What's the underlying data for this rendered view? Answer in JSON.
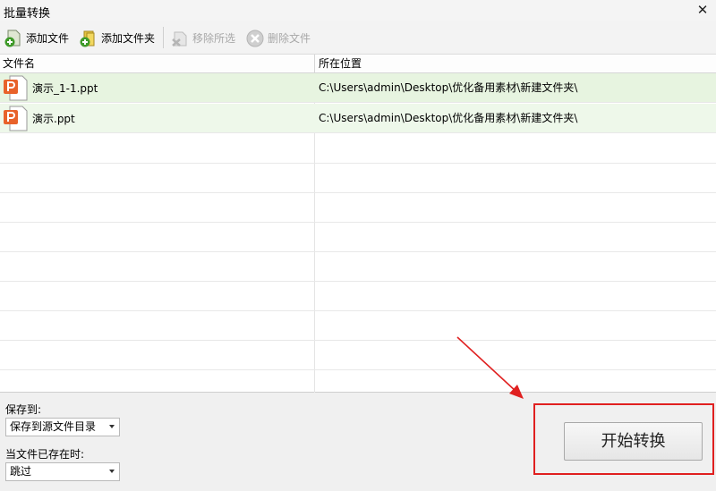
{
  "window": {
    "title": "批量转换",
    "close_icon": "close-icon"
  },
  "toolbar": {
    "add_file": "添加文件",
    "add_folder": "添加文件夹",
    "remove_selected": "移除所选",
    "delete_file": "删除文件"
  },
  "list": {
    "columns": [
      "文件名",
      "所在位置"
    ],
    "rows": [
      {
        "name": "演示_1-1.ppt",
        "path": "C:\\Users\\admin\\Desktop\\优化备用素材\\新建文件夹\\"
      },
      {
        "name": "演示.ppt",
        "path": "C:\\Users\\admin\\Desktop\\优化备用素材\\新建文件夹\\"
      }
    ]
  },
  "options": {
    "save_to_label": "保存到:",
    "save_to_value": "保存到源文件目录",
    "exists_label": "当文件已存在时:",
    "exists_value": "跳过"
  },
  "actions": {
    "start_label": "开始转换"
  },
  "colors": {
    "annotation": "#e02020",
    "row_fill": "#eef8ea",
    "ppt_orange": "#e8622a"
  }
}
